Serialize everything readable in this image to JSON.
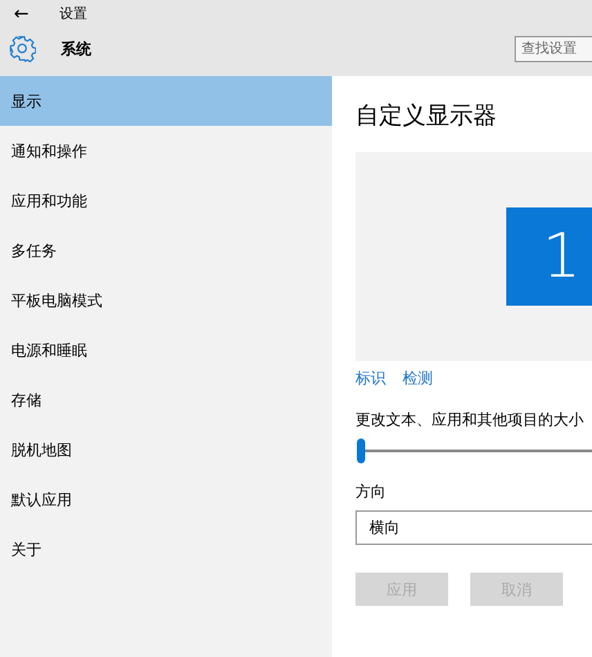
{
  "window": {
    "back": "←",
    "title": "设置"
  },
  "header": {
    "title": "系统",
    "search": {
      "placeholder": "查找设置"
    }
  },
  "sidebar": {
    "items": [
      {
        "label": "显示",
        "selected": true
      },
      {
        "label": "通知和操作",
        "selected": false
      },
      {
        "label": "应用和功能",
        "selected": false
      },
      {
        "label": "多任务",
        "selected": false
      },
      {
        "label": "平板电脑模式",
        "selected": false
      },
      {
        "label": "电源和睡眠",
        "selected": false
      },
      {
        "label": "存储",
        "selected": false
      },
      {
        "label": "脱机地图",
        "selected": false
      },
      {
        "label": "默认应用",
        "selected": false
      },
      {
        "label": "关于",
        "selected": false
      }
    ]
  },
  "main": {
    "heading": "自定义显示器",
    "monitor": "1",
    "links": [
      "标识",
      "检测"
    ],
    "scale": {
      "label": "更改文本、应用和其他项目的大小",
      "level": 0
    },
    "orientation": {
      "label": "方向",
      "value": "横向"
    },
    "buttons": [
      {
        "label": "应用",
        "disabled": true
      },
      {
        "label": "取消",
        "disabled": true
      }
    ]
  }
}
